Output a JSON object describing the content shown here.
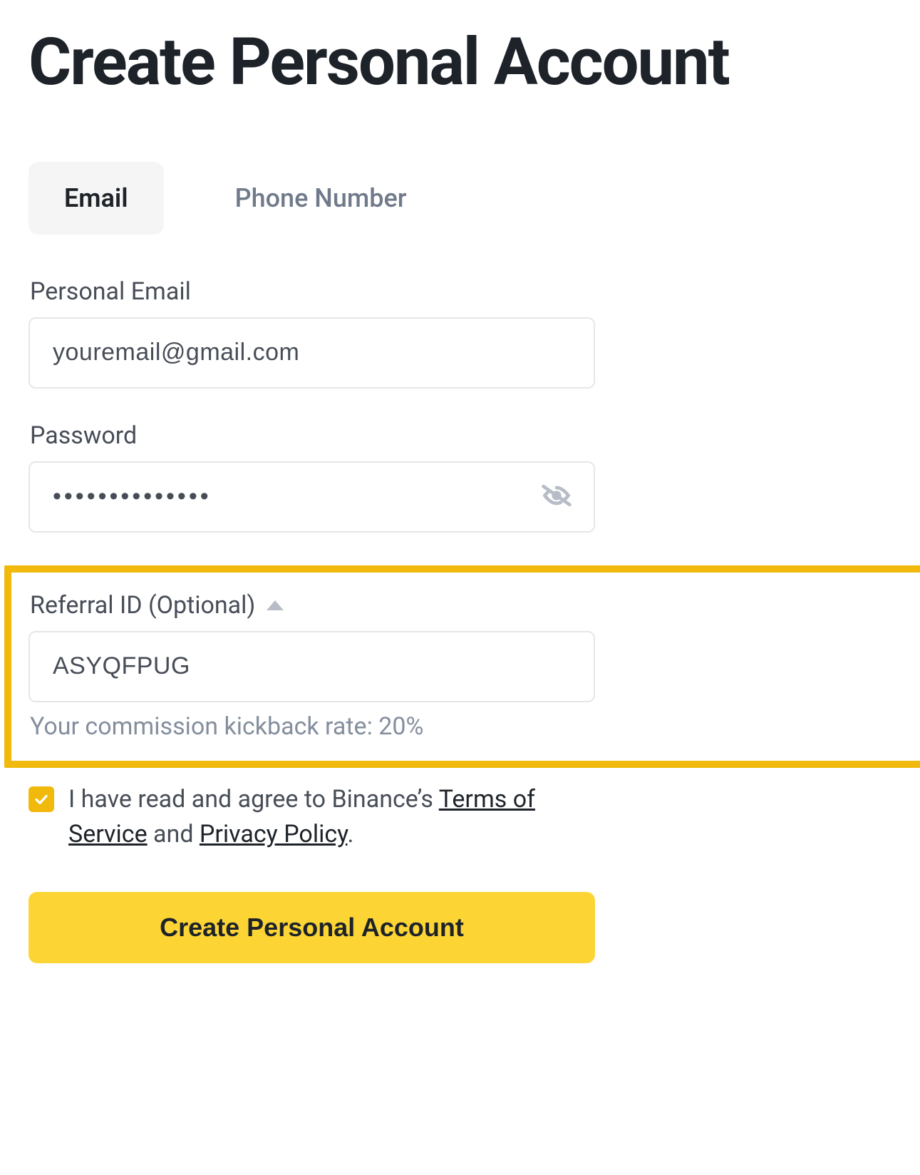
{
  "title": "Create Personal Account",
  "tabs": {
    "email": "Email",
    "phone": "Phone Number"
  },
  "email_field": {
    "label": "Personal Email",
    "value": "youremail@gmail.com"
  },
  "password_field": {
    "label": "Password",
    "value": "••••••••••••••"
  },
  "referral": {
    "label": "Referral ID (Optional)",
    "value": "ASYQFPUG",
    "kickback_text": "Your commission kickback rate: 20%"
  },
  "agree": {
    "prefix": "I have read and agree to Binance’s ",
    "tos": "Terms of Service",
    "mid": " and ",
    "privacy": "Privacy Policy",
    "suffix": "."
  },
  "submit_label": "Create Personal Account"
}
